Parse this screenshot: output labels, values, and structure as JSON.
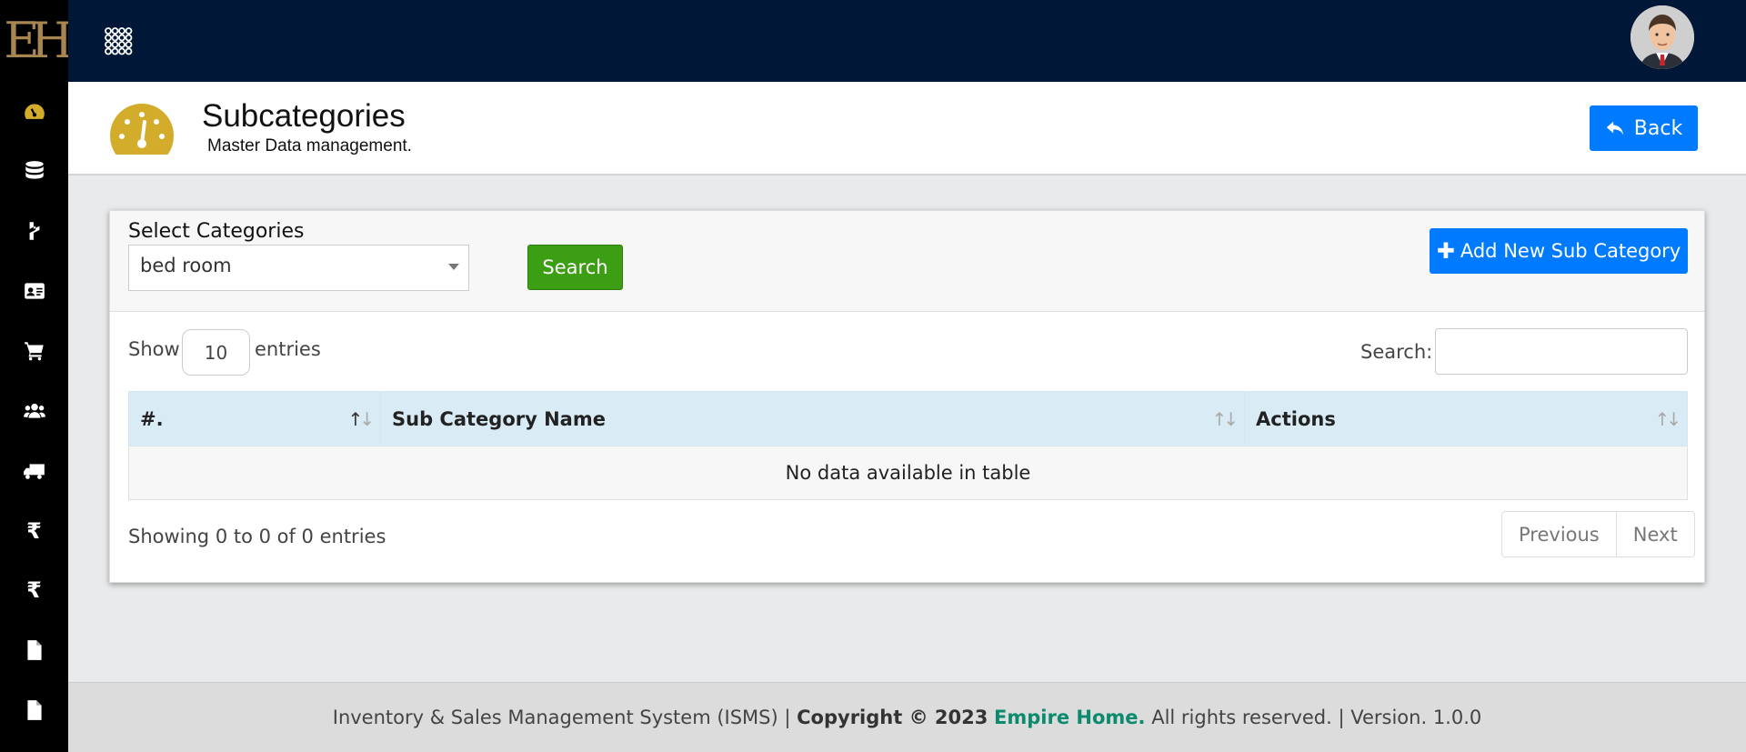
{
  "logo": {
    "text": "EH"
  },
  "sidebar": {
    "items": [
      {
        "icon": "dashboard-icon"
      },
      {
        "icon": "database-icon"
      },
      {
        "icon": "hubspot-icon"
      },
      {
        "icon": "id-card-icon"
      },
      {
        "icon": "cart-icon"
      },
      {
        "icon": "users-icon"
      },
      {
        "icon": "truck-icon"
      },
      {
        "icon": "rupee-icon",
        "glyph": "₹"
      },
      {
        "icon": "rupee-icon",
        "glyph": "₹"
      },
      {
        "icon": "file-icon"
      },
      {
        "icon": "file-icon"
      }
    ]
  },
  "header": {
    "title": "Subcategories",
    "subtitle": "Master Data management.",
    "back_label": "Back"
  },
  "filter": {
    "label": "Select Categories",
    "selected": "bed room",
    "search_label": "Search",
    "add_label": "Add New Sub Category"
  },
  "table": {
    "show_label": "Show",
    "page_length": "10",
    "entries_label": "entries",
    "search_label": "Search:",
    "columns": [
      "#.",
      "Sub Category Name",
      "Actions"
    ],
    "empty_message": "No data available in table",
    "info": "Showing 0 to 0 of 0 entries",
    "prev_label": "Previous",
    "next_label": "Next"
  },
  "footer": {
    "prefix": "Inventory & Sales Management System (ISMS) | ",
    "copyright": "Copyright © 2023",
    "brand": "Empire Home.",
    "suffix": " All rights reserved. | Version. 1.0.0"
  },
  "colors": {
    "topbar": "#001737",
    "accent": "#007bff",
    "search_button": "#3c9e12",
    "icon_gold": "#d4ac2b",
    "table_header": "#d9ecf6"
  }
}
